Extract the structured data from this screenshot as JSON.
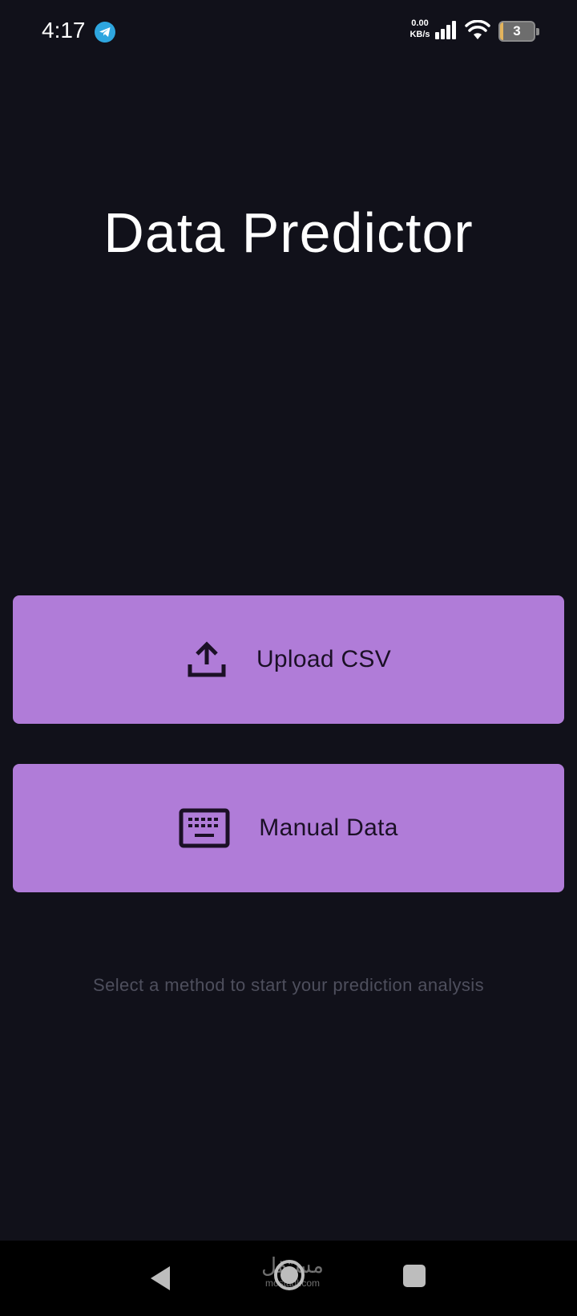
{
  "status_bar": {
    "time": "4:17",
    "net_speed_value": "0.00",
    "net_speed_unit": "KB/s",
    "battery_level": "3",
    "icons": [
      "telegram-icon",
      "signal-icon",
      "wifi-icon",
      "battery-icon"
    ]
  },
  "main": {
    "title": "Data Predictor",
    "buttons": [
      {
        "label": "Upload CSV",
        "icon": "upload-icon"
      },
      {
        "label": "Manual Data",
        "icon": "keyboard-icon"
      }
    ],
    "hint": "Select a method to start your prediction analysis"
  },
  "nav_bar": {
    "icons": [
      "back-icon",
      "home-icon",
      "recents-icon"
    ],
    "watermark_ar": "مستقل",
    "watermark_en": "mostaql.com"
  },
  "colors": {
    "background": "#11111a",
    "button": "#b07cd8",
    "button_text": "#1b1026",
    "hint": "#4e4f5d"
  }
}
